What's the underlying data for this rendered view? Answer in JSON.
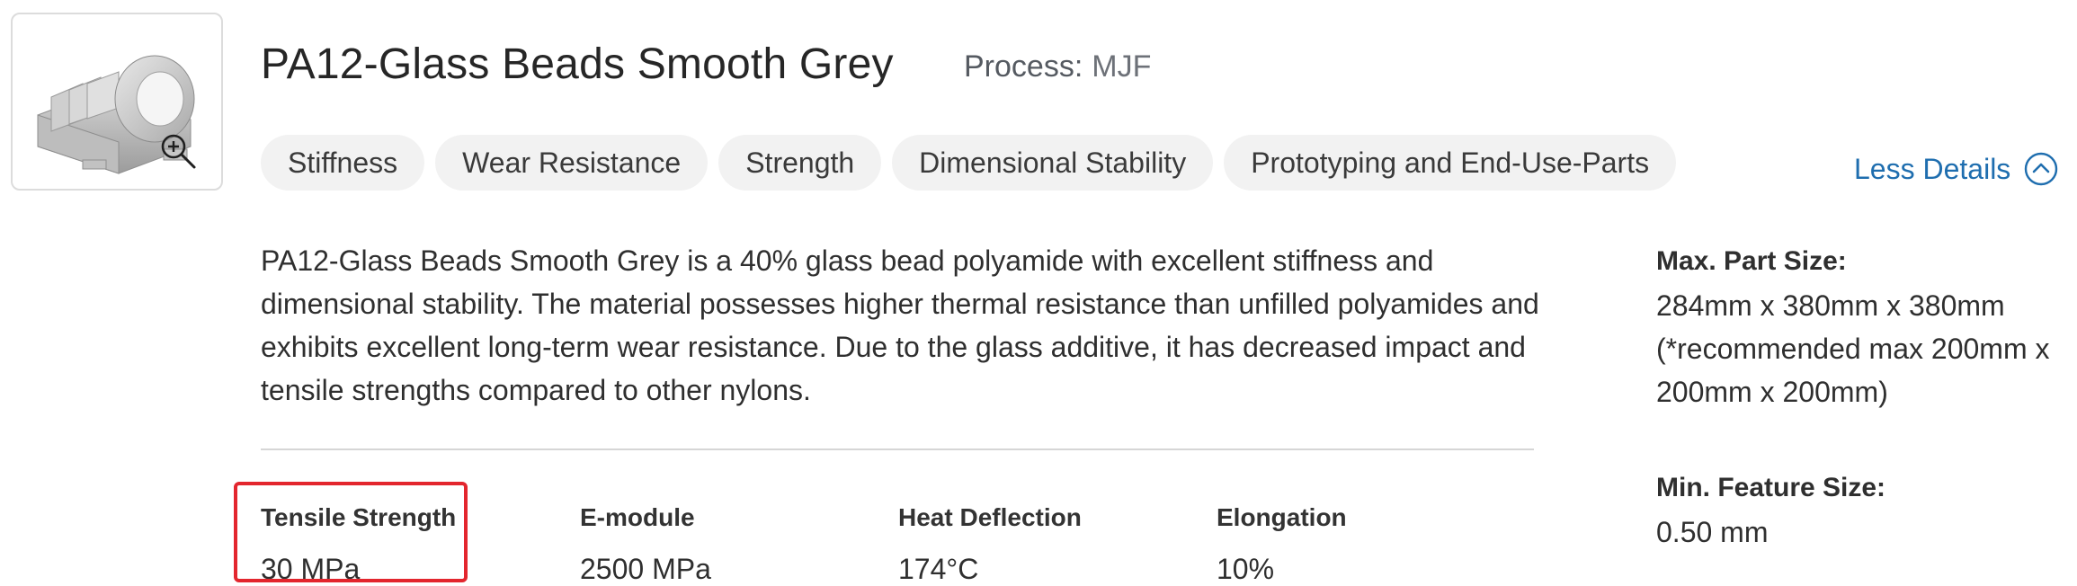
{
  "material": {
    "title": "PA12-Glass Beads Smooth Grey",
    "process_label": "Process:",
    "process_value": "MJF"
  },
  "tags": [
    "Stiffness",
    "Wear Resistance",
    "Strength",
    "Dimensional Stability",
    "Prototyping and End-Use-Parts"
  ],
  "toggle": {
    "label": "Less Details",
    "icon": "chevron-up-circle-icon",
    "color": "#1f6eaf"
  },
  "description": "PA12-Glass Beads Smooth Grey is a 40% glass bead polyamide with excellent stiffness and dimensional stability. The material possesses higher thermal resistance than unfilled polyamides and exhibits excellent long-term wear resistance. Due to the glass additive, it has decreased impact and tensile strengths compared to other nylons.",
  "stats": [
    {
      "label": "Tensile Strength",
      "value": "30 MPa"
    },
    {
      "label": "E-module",
      "value": "2500 MPa"
    },
    {
      "label": "Heat Deflection",
      "value": "174°C"
    },
    {
      "label": "Elongation",
      "value": "10%"
    }
  ],
  "specs": {
    "max_part_size_label": "Max. Part Size:",
    "max_part_size_value": "284mm x 380mm x 380mm (*recommended max 200mm x 200mm x 200mm)",
    "min_feature_size_label": "Min. Feature Size:",
    "min_feature_size_value": "0.50 mm"
  },
  "highlight": {
    "color": "#e3262e"
  },
  "thumbnail": {
    "zoom_icon": "zoom-in-icon"
  }
}
